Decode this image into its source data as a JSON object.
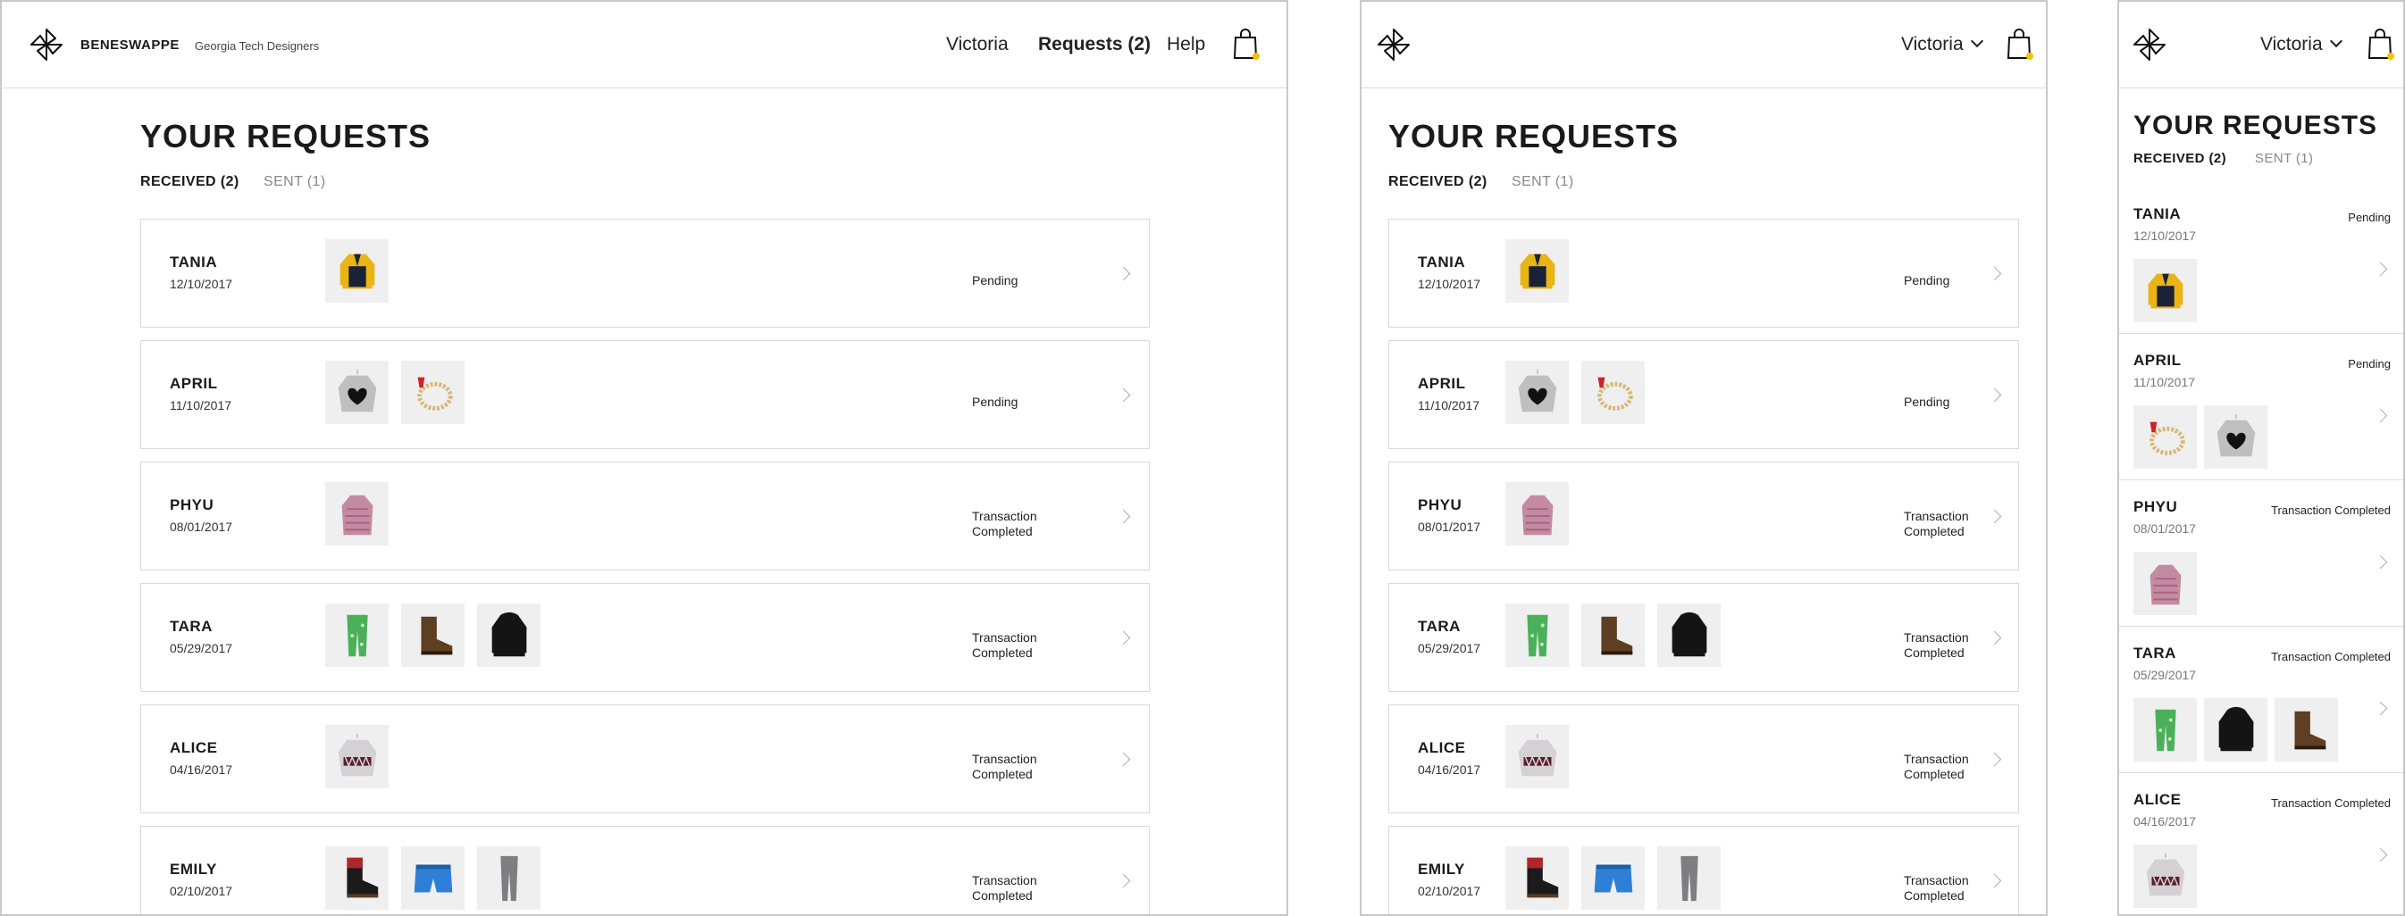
{
  "brand": {
    "name": "BENESWAPPE",
    "subtitle": "Georgia Tech Designers"
  },
  "nav": {
    "user": "Victoria",
    "requests": "Requests (2)",
    "help": "Help"
  },
  "page": {
    "title": "YOUR REQUESTS"
  },
  "tabs": {
    "received": "RECEIVED (2)",
    "sent": "SENT (1)"
  },
  "requests": [
    {
      "name": "TANIA",
      "date": "12/10/2017",
      "status": "Pending",
      "status_lines": [
        "Pending"
      ],
      "items": [
        "yellow-jacket"
      ]
    },
    {
      "name": "APRIL",
      "date": "11/10/2017",
      "status": "Pending",
      "status_lines": [
        "Pending"
      ],
      "items": [
        "heart-sweater",
        "beaded-bracelet"
      ]
    },
    {
      "name": "PHYU",
      "date": "08/01/2017",
      "status": "Transaction Completed",
      "status_lines": [
        "Transaction",
        "Completed"
      ],
      "items": [
        "pink-top"
      ]
    },
    {
      "name": "TARA",
      "date": "05/29/2017",
      "status": "Transaction Completed",
      "status_lines": [
        "Transaction",
        "Completed"
      ],
      "items": [
        "green-pants",
        "brown-boots",
        "black-hoodie"
      ]
    },
    {
      "name": "ALICE",
      "date": "04/16/2017",
      "status": "Transaction Completed",
      "status_lines": [
        "Transaction",
        "Completed"
      ],
      "items": [
        "patterned-sweater"
      ]
    },
    {
      "name": "EMILY",
      "date": "02/10/2017",
      "status": "Transaction Completed",
      "status_lines": [
        "Transaction",
        "Completed"
      ],
      "items": [
        "winter-boots",
        "blue-shorts",
        "grey-pants"
      ]
    }
  ],
  "mobile_item_order": [
    [
      "yellow-jacket"
    ],
    [
      "beaded-bracelet",
      "heart-sweater"
    ],
    [
      "pink-top"
    ],
    [
      "green-pants",
      "black-hoodie",
      "brown-boots"
    ],
    [
      "patterned-sweater"
    ]
  ],
  "icons": {
    "logo": "pinwheel-logo-icon",
    "cart": "shopping-bag-icon",
    "row": "chevron-right-icon",
    "menu": "chevron-down-icon"
  },
  "colors": {
    "text": "#1a1a1a",
    "muted": "#888888",
    "border": "#d9d9d9",
    "thumb_bg": "#efefef",
    "cart_dot": "#f2c200"
  }
}
